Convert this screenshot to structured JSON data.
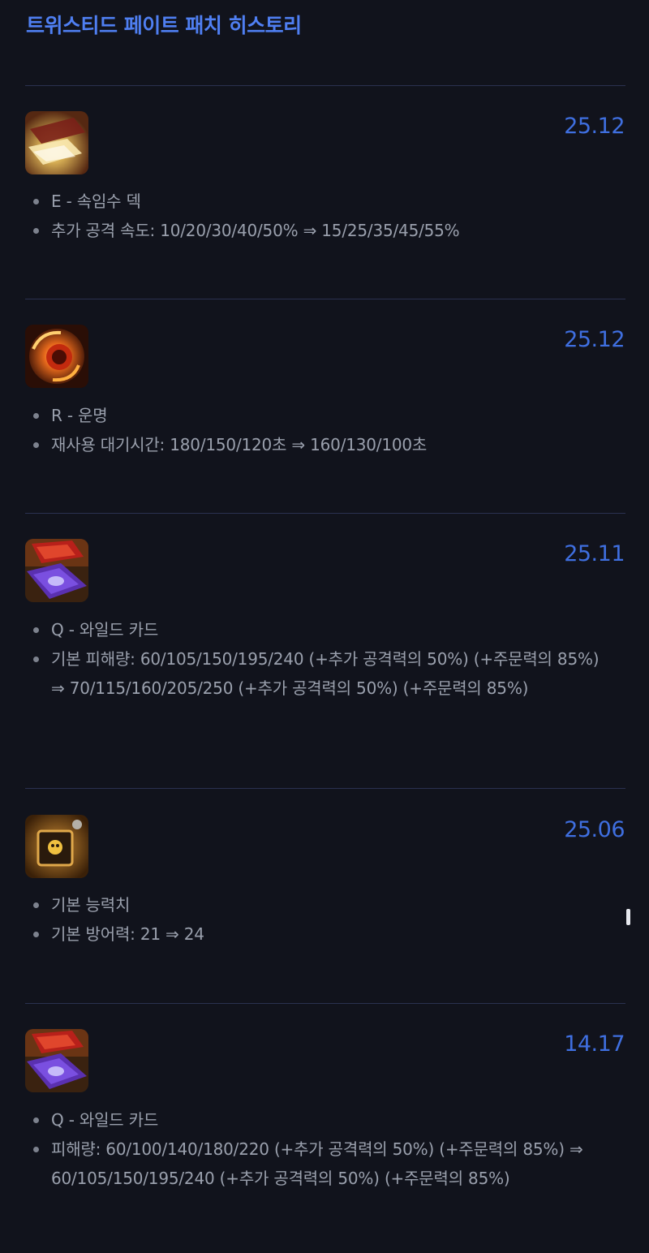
{
  "page": {
    "title": "트위스티드 페이트 패치 히스토리"
  },
  "patches": [
    {
      "version": "25.12",
      "icon": "stacked-deck-icon",
      "changes": [
        "E - 속임수 덱",
        "추가 공격 속도: 10/20/30/40/50% ⇒ 15/25/35/45/55%"
      ]
    },
    {
      "version": "25.12",
      "icon": "destiny-icon",
      "changes": [
        "R - 운명",
        "재사용 대기시간: 180/150/120초 ⇒ 160/130/100초"
      ]
    },
    {
      "version": "25.11",
      "icon": "wild-cards-icon",
      "changes": [
        "Q - 와일드 카드",
        "기본 피해량: 60/105/150/195/240 (+추가 공격력의 50%) (+주문력의 85%) ⇒ 70/115/160/205/250 (+추가 공격력의 50%) (+주문력의 85%)"
      ]
    },
    {
      "version": "25.06",
      "icon": "loaded-dice-icon",
      "changes": [
        "기본 능력치",
        "기본 방어력: 21 ⇒ 24"
      ]
    },
    {
      "version": "14.17",
      "icon": "wild-cards-icon",
      "changes": [
        "Q - 와일드 카드",
        "피해량: 60/100/140/180/220 (+추가 공격력의 50%) (+주문력의 85%) ⇒ 60/105/150/195/240 (+추가 공격력의 50%) (+주문력의 85%)"
      ]
    }
  ],
  "colors": {
    "background": "#11131c",
    "title": "#4f7ff2",
    "version": "#3f6fe0",
    "body_text": "#9aa0ad",
    "divider": "#2a3150"
  }
}
